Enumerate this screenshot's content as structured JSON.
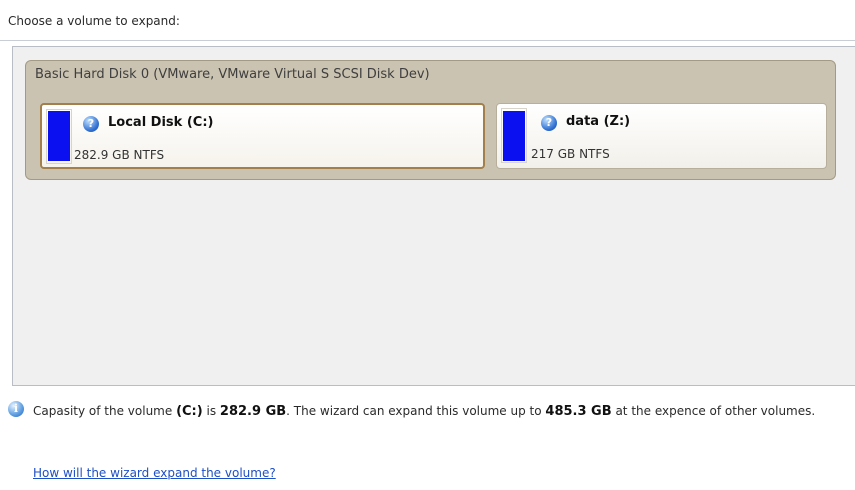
{
  "prompt": "Choose a volume to expand:",
  "disk": {
    "title": "Basic Hard Disk 0 (VMware, VMware Virtual S SCSI Disk Dev)",
    "volumes": [
      {
        "name": "Local Disk (C:)",
        "size": "282.9 GB NTFS",
        "selected": true,
        "bar_color": "#0a10f0",
        "icon": "question-icon"
      },
      {
        "name": "data (Z:)",
        "size": "217 GB NTFS",
        "selected": false,
        "bar_color": "#0a10f0",
        "icon": "question-icon"
      }
    ]
  },
  "info": {
    "icon": "info-icon",
    "part1": "Capasity of the volume ",
    "volume": "(C:)",
    "part2": " is ",
    "capacity": "282.9 GB",
    "part3": ". The wizard can expand this volume up to ",
    "max_size": "485.3 GB",
    "part4": " at the expence of other volumes."
  },
  "link": {
    "text": "How will the wizard expand the volume?"
  },
  "colors": {
    "disk_group_bg": "#cbc3b1",
    "selected_border": "#a37f4c",
    "link": "#1f4fc4"
  }
}
